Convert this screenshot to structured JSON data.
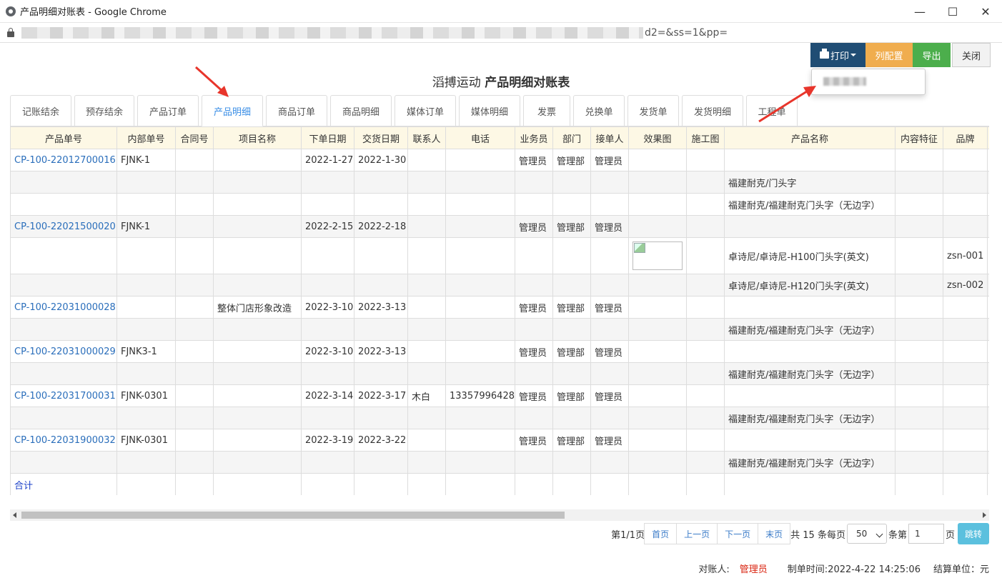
{
  "window": {
    "title": "产品明细对账表 - Google Chrome",
    "minimize": "—",
    "maximize": "☐",
    "close": "✕"
  },
  "address": {
    "url_tail": "d2=&ss=1&pp="
  },
  "toolbar": {
    "print": "打印",
    "columns": "列配置",
    "export": "导出",
    "close": "关闭"
  },
  "page_title": {
    "company": "滔搏运动",
    "name": "产品明细对账表"
  },
  "tabs": [
    "记账结余",
    "预存结余",
    "产品订单",
    "产品明细",
    "商品订单",
    "商品明细",
    "媒体订单",
    "媒体明细",
    "发票",
    "兑换单",
    "发货单",
    "发货明细",
    "工程单"
  ],
  "columns": [
    "产品单号",
    "内部单号",
    "合同号",
    "项目名称",
    "下单日期",
    "交货日期",
    "联系人",
    "电话",
    "业务员",
    "部门",
    "接单人",
    "效果图",
    "施工图",
    "产品名称",
    "内容特征",
    "品牌"
  ],
  "rows": [
    [
      "CP-100-22012700016",
      "FJNK-1",
      "",
      "",
      "2022-1-27",
      "2022-1-30",
      "",
      "",
      "管理员",
      "管理部",
      "管理员",
      "",
      "",
      "",
      "",
      ""
    ],
    [
      "",
      "",
      "",
      "",
      "",
      "",
      "",
      "",
      "",
      "",
      "",
      "",
      "",
      "福建耐克/门头字",
      "",
      ""
    ],
    [
      "",
      "",
      "",
      "",
      "",
      "",
      "",
      "",
      "",
      "",
      "",
      "",
      "",
      "福建耐克/福建耐克门头字（无边字）",
      "",
      ""
    ],
    [
      "CP-100-22021500020",
      "FJNK-1",
      "",
      "",
      "2022-2-15",
      "2022-2-18",
      "",
      "",
      "管理员",
      "管理部",
      "管理员",
      "",
      "",
      "",
      "",
      ""
    ],
    [
      "",
      "",
      "",
      "",
      "",
      "",
      "",
      "",
      "",
      "",
      "",
      "",
      "",
      "卓诗尼/卓诗尼-H100门头字(英文)",
      "",
      "zsn-001"
    ],
    [
      "",
      "",
      "",
      "",
      "",
      "",
      "",
      "",
      "",
      "",
      "",
      "",
      "",
      "卓诗尼/卓诗尼-H120门头字(英文)",
      "",
      "zsn-002"
    ],
    [
      "CP-100-22031000028",
      "",
      "",
      "整体门店形象改造",
      "2022-3-10",
      "2022-3-13",
      "",
      "",
      "管理员",
      "管理部",
      "管理员",
      "",
      "",
      "",
      "",
      ""
    ],
    [
      "",
      "",
      "",
      "",
      "",
      "",
      "",
      "",
      "",
      "",
      "",
      "",
      "",
      "福建耐克/福建耐克门头字（无边字）",
      "",
      ""
    ],
    [
      "CP-100-22031000029",
      "FJNK3-1",
      "",
      "",
      "2022-3-10",
      "2022-3-13",
      "",
      "",
      "管理员",
      "管理部",
      "管理员",
      "",
      "",
      "",
      "",
      ""
    ],
    [
      "",
      "",
      "",
      "",
      "",
      "",
      "",
      "",
      "",
      "",
      "",
      "",
      "",
      "福建耐克/福建耐克门头字（无边字）",
      "",
      ""
    ],
    [
      "CP-100-22031700031",
      "FJNK-0301",
      "",
      "",
      "2022-3-14",
      "2022-3-17",
      "木白",
      "13357996428",
      "管理员",
      "管理部",
      "管理员",
      "",
      "",
      "",
      "",
      ""
    ],
    [
      "",
      "",
      "",
      "",
      "",
      "",
      "",
      "",
      "",
      "",
      "",
      "",
      "",
      "福建耐克/福建耐克门头字（无边字）",
      "",
      ""
    ],
    [
      "CP-100-22031900032",
      "FJNK-0301",
      "",
      "",
      "2022-3-19",
      "2022-3-22",
      "",
      "",
      "管理员",
      "管理部",
      "管理员",
      "",
      "",
      "",
      "",
      ""
    ],
    [
      "",
      "",
      "",
      "",
      "",
      "",
      "",
      "",
      "",
      "",
      "",
      "",
      "",
      "福建耐克/福建耐克门头字（无边字）",
      "",
      ""
    ],
    [
      "合计",
      "",
      "",
      "",
      "",
      "",
      "",
      "",
      "",
      "",
      "",
      "",
      "",
      "",
      "",
      ""
    ]
  ],
  "pagination": {
    "page_info": "第1/1页",
    "first": "首页",
    "prev": "上一页",
    "next": "下一页",
    "last": "末页",
    "total": "共 15 条每页",
    "per_page": "50",
    "per_unit": "条第",
    "page_value": "1",
    "page_unit": "页",
    "jump": "跳转"
  },
  "footer": {
    "reconciler_label": "对账人:",
    "reconciler": "管理员",
    "made_time": "制单时间:2022-4-22 14:25:06",
    "settle_unit": "结算单位：元"
  },
  "colors": {
    "primary": "#204d74",
    "warning": "#f0ad4e",
    "success": "#4cae4c",
    "link": "#2a6ebb",
    "arrow": "#e8352b"
  }
}
